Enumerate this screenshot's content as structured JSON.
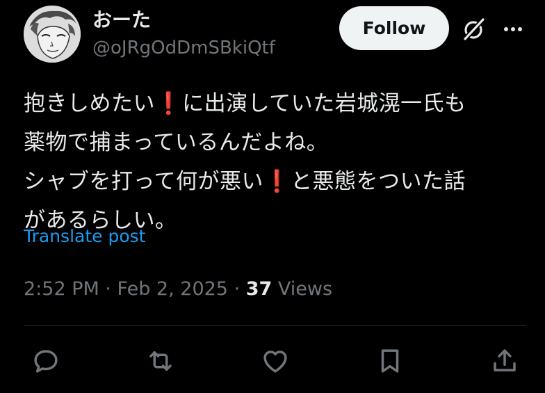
{
  "author": {
    "display_name": "おーた",
    "handle": "@oJRgOdDmSBkiQtf"
  },
  "follow_label": "Follow",
  "tweet": {
    "lines": [
      {
        "before": "抱きしめたい",
        "mark": "❗",
        "after": "に出演していた岩城滉一氏も"
      },
      {
        "before": "薬物で捕まっているんだよね。",
        "mark": "",
        "after": ""
      },
      {
        "before": "シャブを打って何が悪い",
        "mark": "❗",
        "after": "と悪態をついた話"
      },
      {
        "before": "があるらしい。",
        "mark": "",
        "after": ""
      }
    ],
    "translate_label": "Translate post"
  },
  "meta": {
    "time": "2:52 PM",
    "sep1": " · ",
    "date": "Feb 2, 2025",
    "sep2": " · ",
    "views_count": "37",
    "views_label": " Views"
  },
  "icons": {
    "grok": "grok-icon",
    "more": "more-icon",
    "reply": "reply-icon",
    "repost": "repost-icon",
    "like": "like-icon",
    "bookmark": "bookmark-icon",
    "share": "share-icon"
  },
  "colors": {
    "background": "#000000",
    "text": "#e7e9ea",
    "secondary": "#71767b",
    "link": "#1d9bf0",
    "exclamation": "#d9272e",
    "follow_bg": "#eff3f4"
  }
}
